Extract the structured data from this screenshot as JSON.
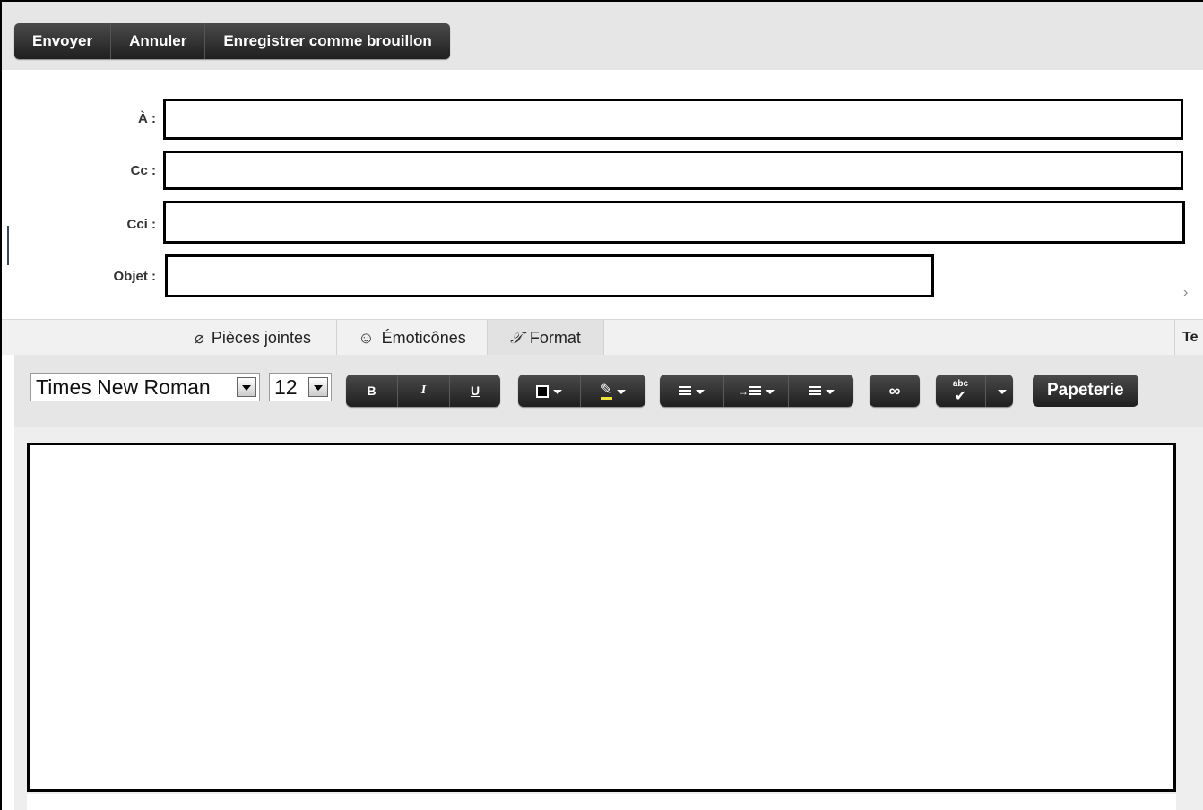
{
  "actions": {
    "send": "Envoyer",
    "cancel": "Annuler",
    "save_draft": "Enregistrer comme brouillon"
  },
  "fields": {
    "to_label": "À :",
    "to_value": "",
    "cc_label": "Cc :",
    "cc_value": "",
    "bcc_label": "Cci :",
    "bcc_value": "",
    "subject_label": "Objet :",
    "subject_value": ""
  },
  "tabs": {
    "attachments": "Pièces jointes",
    "emoticons": "Émoticônes",
    "format": "Format",
    "edge": "Te",
    "active": "format"
  },
  "toolbar": {
    "font_family": "Times New Roman",
    "font_size": "12",
    "bold": "B",
    "italic": "I",
    "underline": "U",
    "spellcheck_icon_text": "abc",
    "stationery": "Papeterie",
    "text_color": "#000000",
    "highlight_color": "#f0e23c"
  },
  "editor": {
    "body": ""
  }
}
